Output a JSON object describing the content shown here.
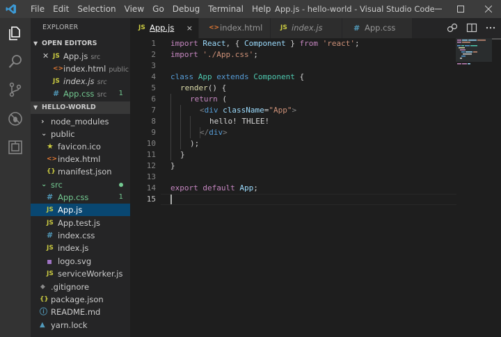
{
  "titlebar": {
    "menu": [
      "File",
      "Edit",
      "Selection",
      "View",
      "Go",
      "Debug",
      "Terminal",
      "Help"
    ],
    "window_title": "App.js - hello-world - Visual Studio Code"
  },
  "sidebar": {
    "header": "EXPLORER",
    "open_editors_title": "OPEN EDITORS",
    "open_editors": [
      {
        "name": "App.js",
        "desc": "src",
        "icon": "JS",
        "italic": false,
        "close": true
      },
      {
        "name": "index.html",
        "desc": "public",
        "icon": "<>",
        "italic": false
      },
      {
        "name": "index.js",
        "desc": "src",
        "icon": "JS",
        "italic": true
      },
      {
        "name": "App.css",
        "desc": "src",
        "icon": "#",
        "italic": false,
        "badge": "1"
      }
    ],
    "project_title": "HELLO-WORLD",
    "tree": [
      {
        "name": "node_modules",
        "icon": "›"
      },
      {
        "name": "public",
        "icon": "⌄"
      },
      {
        "name": "favicon.ico",
        "icon": "★"
      },
      {
        "name": "index.html",
        "icon": "<>"
      },
      {
        "name": "manifest.json",
        "icon": "{}"
      },
      {
        "name": "src",
        "icon": "⌄"
      },
      {
        "name": "App.css",
        "icon": "#",
        "badge": "1"
      },
      {
        "name": "App.js",
        "icon": "JS"
      },
      {
        "name": "App.test.js",
        "icon": "JS"
      },
      {
        "name": "index.css",
        "icon": "#"
      },
      {
        "name": "index.js",
        "icon": "JS"
      },
      {
        "name": "logo.svg",
        "icon": "▪"
      },
      {
        "name": "serviceWorker.js",
        "icon": "JS"
      },
      {
        "name": ".gitignore",
        "icon": "◆"
      },
      {
        "name": "package.json",
        "icon": "{}"
      },
      {
        "name": "README.md",
        "icon": "ⓘ"
      },
      {
        "name": "yarn.lock",
        "icon": "▲"
      }
    ]
  },
  "tabs": [
    {
      "label": "App.js",
      "icon": "JS",
      "close": "×"
    },
    {
      "label": "index.html",
      "icon": "<>"
    },
    {
      "label": "index.js",
      "icon": "JS"
    },
    {
      "label": "App.css",
      "icon": "#"
    }
  ],
  "editor": {
    "line_numbers": [
      "1",
      "2",
      "3",
      "4",
      "5",
      "6",
      "7",
      "8",
      "9",
      "10",
      "11",
      "12",
      "13",
      "14",
      "15"
    ],
    "code": {
      "l1": [
        "import",
        " ",
        "React",
        ", { ",
        "Component",
        " } ",
        "from",
        " ",
        "'react'",
        ";"
      ],
      "l2": [
        "import",
        " ",
        "'./App.css'",
        ";"
      ],
      "l4": [
        "class",
        " ",
        "App",
        " ",
        "extends",
        " ",
        "Component",
        " {"
      ],
      "l5": [
        "render",
        "() {"
      ],
      "l6": [
        "return",
        " ("
      ],
      "l7": [
        "<",
        "div",
        " ",
        "className",
        "=",
        "\"App\"",
        ">"
      ],
      "l8": [
        "hello! THLEE!"
      ],
      "l9": [
        "</",
        "div",
        ">"
      ],
      "l10": [
        ");"
      ],
      "l11": [
        "}"
      ],
      "l12": [
        "}"
      ],
      "l14": [
        "export",
        " ",
        "default",
        " ",
        "App",
        ";"
      ]
    }
  }
}
